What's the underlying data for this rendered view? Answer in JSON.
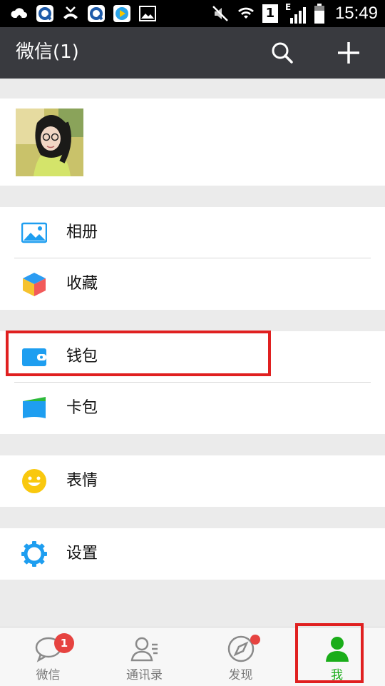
{
  "status_bar": {
    "time": "15:49",
    "sim_number": "1",
    "network_letter": "E"
  },
  "header": {
    "title": "微信(1)",
    "search_icon": "search-icon",
    "add_icon": "plus-icon"
  },
  "menu": {
    "items": [
      {
        "label": "相册",
        "icon": "photo-album-icon"
      },
      {
        "label": "收藏",
        "icon": "favorites-cube-icon"
      },
      {
        "label": "钱包",
        "icon": "wallet-icon"
      },
      {
        "label": "卡包",
        "icon": "card-pack-icon"
      },
      {
        "label": "表情",
        "icon": "smiley-icon"
      },
      {
        "label": "设置",
        "icon": "gear-icon"
      }
    ]
  },
  "tabbar": {
    "tabs": [
      {
        "label": "微信",
        "badge": "1",
        "icon": "chat-bubble-icon"
      },
      {
        "label": "通讯录",
        "icon": "contacts-icon"
      },
      {
        "label": "发现",
        "icon": "compass-icon"
      },
      {
        "label": "我",
        "icon": "person-icon"
      }
    ],
    "active": "我"
  },
  "colors": {
    "header_bg": "#393a3f",
    "accent_green": "#1aad19",
    "highlight_red": "#e02020",
    "badge_red": "#e64340",
    "icon_blue": "#1e9ef0"
  }
}
